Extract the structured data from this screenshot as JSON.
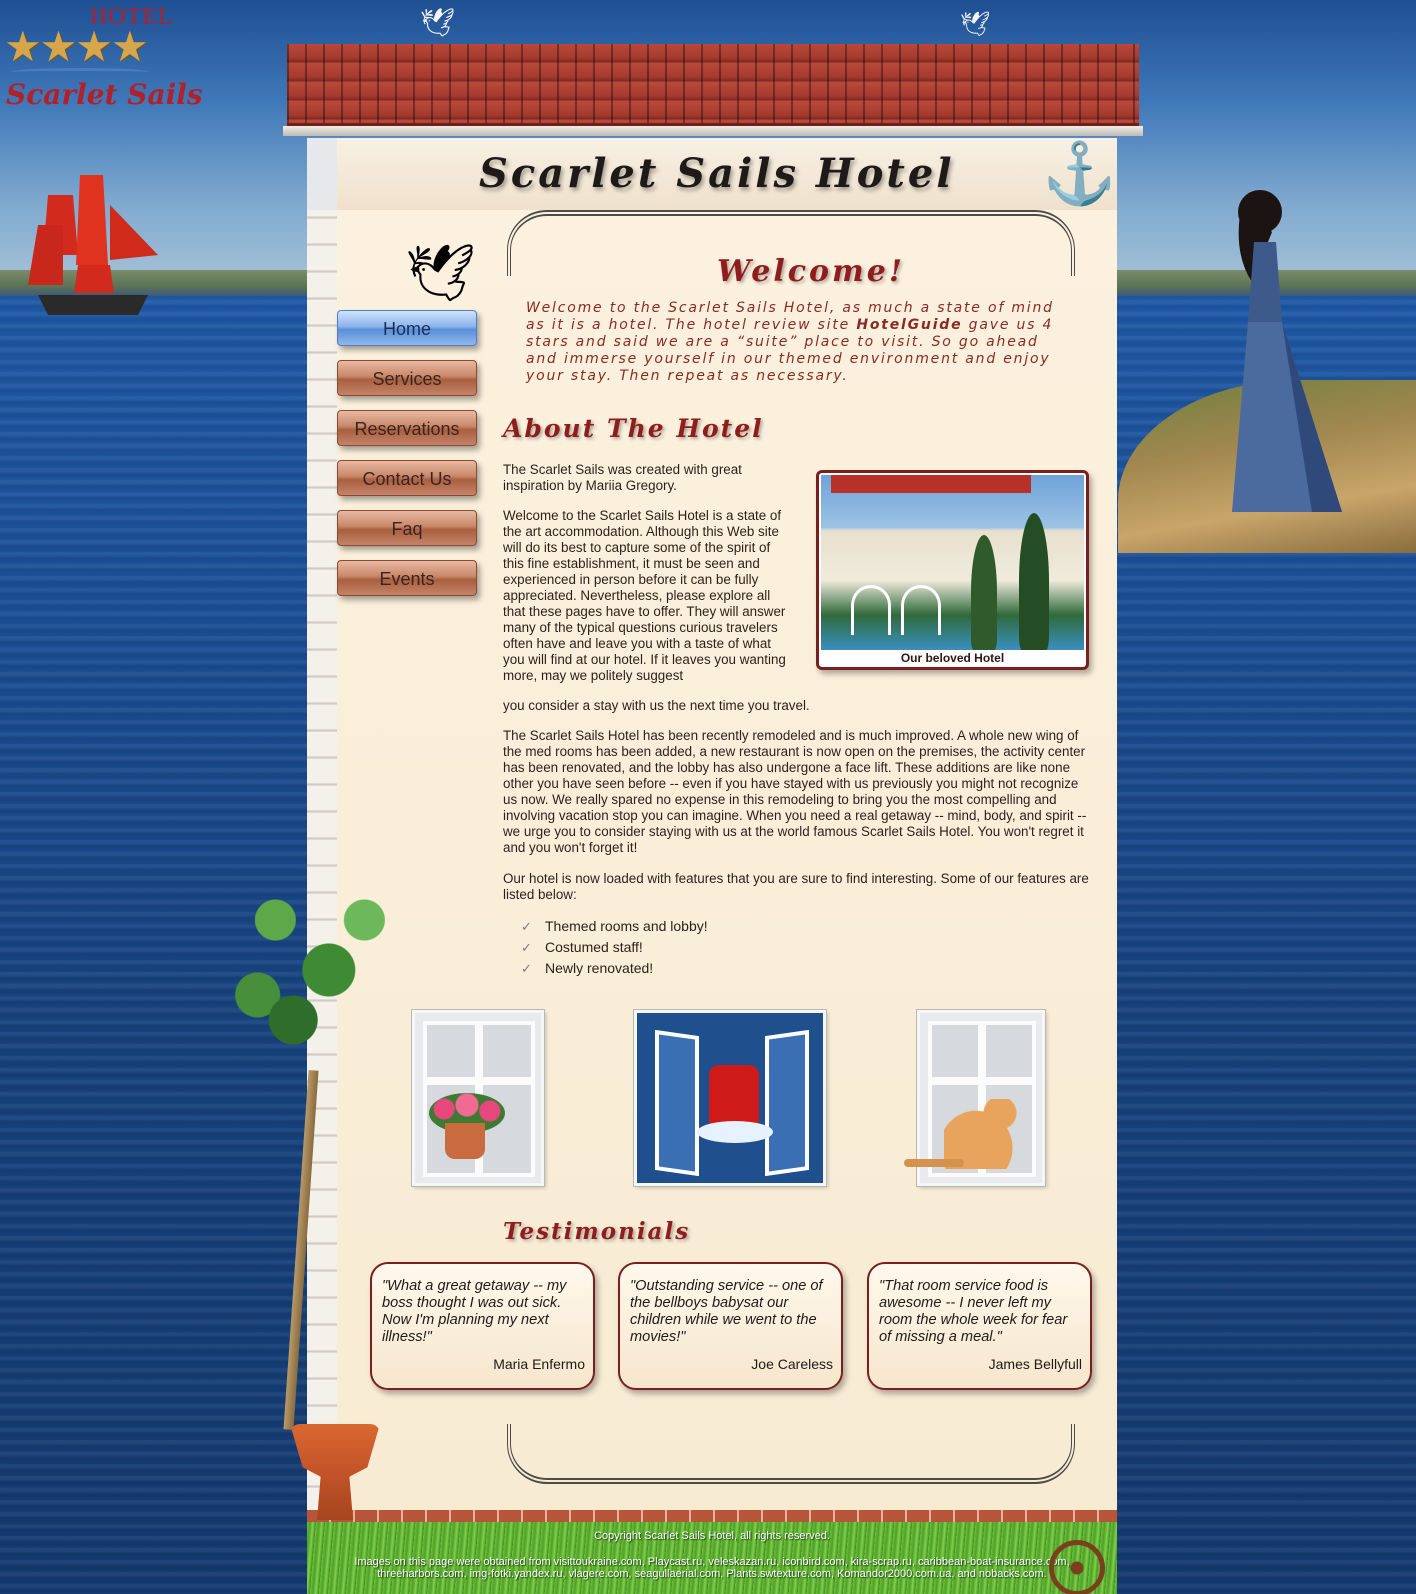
{
  "logo": {
    "hotel_word": "HOTEL",
    "stars": "★★★★",
    "name": "Scarlet Sails"
  },
  "site_title": "Scarlet Sails Hotel",
  "nav": {
    "items": [
      {
        "label": "Home",
        "active": true
      },
      {
        "label": "Services"
      },
      {
        "label": "Reservations"
      },
      {
        "label": "Contact Us"
      },
      {
        "label": "Faq"
      },
      {
        "label": "Events"
      }
    ]
  },
  "welcome": {
    "heading": "Welcome!",
    "text_before": "Welcome to the Scarlet Sails Hotel, as much a state of mind as it is a hotel. The hotel review site ",
    "text_bold": "HotelGuide",
    "text_after": " gave us 4 stars and said we are a “suite” place to visit. So go ahead and immerse yourself in our themed environment and enjoy your stay. Then repeat as necessary."
  },
  "about": {
    "heading": "About The Hotel",
    "p1": "The Scarlet Sails was created with great inspiration by Mariia Gregory.",
    "p2": "Welcome to the Scarlet Sails Hotel is a state of the art accommodation. Although this Web site will do its best to capture some of the spirit of this fine establishment, it must be seen and experienced in person before it can be fully appreciated. Nevertheless, please explore all that these pages have to offer. They will answer many of the typical questions curious travelers often have and leave you with a taste of what you will find at our hotel. If it leaves you wanting more, may we politely suggest",
    "p2_tail": "you consider a stay with us the next time you travel.",
    "p3": "The Scarlet Sails Hotel has been recently remodeled and is much improved. A whole new wing of the med rooms has been added, a new restaurant is now open on the premises, the activity center has been renovated, and the lobby has also undergone a face lift. These additions are like none other you have seen before -- even if you have stayed with us previously you might not recognize us now. We really spared no expense in this remodeling to bring you the most compelling and involving vacation stop you can imagine. When you need a real getaway -- mind, body, and spirit -- we urge you to consider staying with us at the world famous Scarlet Sails Hotel. You won't regret it and you won't forget it!",
    "p4": "Our hotel is now loaded with features that you are sure to find interesting. Some of our features are listed below:",
    "photo_caption": "Our beloved Hotel",
    "features": [
      "Themed rooms and lobby!",
      "Costumed staff!",
      "Newly renovated!"
    ]
  },
  "testimonials": {
    "heading": "Testimonials",
    "items": [
      {
        "quote": "\"What a great getaway -- my boss thought I was out sick. Now I'm planning my next illness!\"",
        "author": "Maria Enfermo"
      },
      {
        "quote": "\"Outstanding service -- one of the bellboys babysat our children while we went to the movies!\"",
        "author": "Joe Careless"
      },
      {
        "quote": "\"That room service food is awesome -- I never left my room the whole week for fear of missing a meal.\"",
        "author": "James Bellyfull"
      }
    ]
  },
  "footer": {
    "copyright": "Copyright Scarlet Sails Hotel, all rights reserved.",
    "credits": "Images on this page were obtained from visittoukraine.com, Playcast.ru, veleskazan.ru, iconbird.com, kira-scrap.ru, caribbean-boat-insurance.com, threeharbors.com, img-fotki.yandex.ru, vlagere.com, seagullaerial.com, Plants.swtexture.com, Komandor2000.com.ua, and nobacks.com."
  },
  "icons": {
    "check": "✓",
    "anchor": "⚓",
    "seagull": "seagull-icon"
  },
  "colors": {
    "accent": "#8f1d1d",
    "nav_active": "#5b8fd9",
    "nav": "#c88769"
  }
}
